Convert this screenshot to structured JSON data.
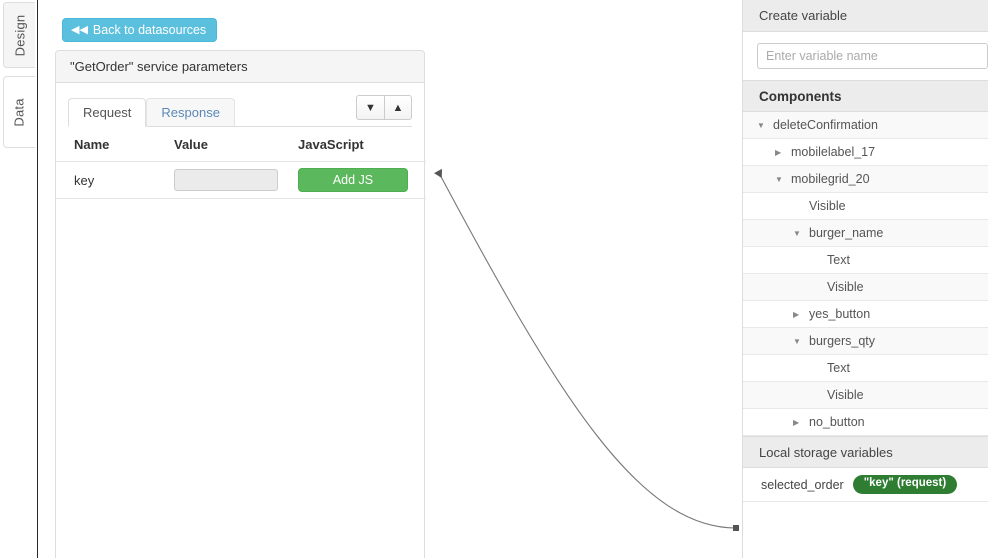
{
  "rail": {
    "tabs": [
      {
        "label": "Design",
        "active": true
      },
      {
        "label": "Data",
        "active": false
      }
    ]
  },
  "toolbar": {
    "back_label": "Back to datasources",
    "back_icon": "fast-backward-icon",
    "back_color": "#5bc0de"
  },
  "card": {
    "title": "\"GetOrder\" service parameters",
    "tabs": [
      {
        "label": "Request",
        "active": true
      },
      {
        "label": "Response",
        "active": false
      }
    ],
    "sort_buttons": [
      {
        "name": "chevron-down-icon",
        "glyph": "▼"
      },
      {
        "name": "chevron-up-icon",
        "glyph": "▲"
      }
    ],
    "table": {
      "headers": [
        "Name",
        "Value",
        "JavaScript"
      ],
      "rows": [
        {
          "name": "key",
          "value": "",
          "value_placeholder": "",
          "js_label": "Add JS",
          "js_color": "#5cb85c"
        }
      ]
    }
  },
  "right_panel": {
    "create_variable_header": "Create variable",
    "variable_placeholder": "Enter variable name",
    "variable_value": "",
    "components_header": "Components",
    "tree": [
      {
        "label": "deleteConfirmation",
        "indent": 0,
        "caret": "▼",
        "alt": true
      },
      {
        "label": "mobilelabel_17",
        "indent": 1,
        "caret": "▶",
        "alt": false
      },
      {
        "label": "mobilegrid_20",
        "indent": 1,
        "caret": "▼",
        "alt": true
      },
      {
        "label": "Visible",
        "indent": 2,
        "caret": "",
        "alt": false
      },
      {
        "label": "burger_name",
        "indent": 2,
        "caret": "▼",
        "alt": true
      },
      {
        "label": "Text",
        "indent": 3,
        "caret": "",
        "alt": false
      },
      {
        "label": "Visible",
        "indent": 3,
        "caret": "",
        "alt": true
      },
      {
        "label": "yes_button",
        "indent": 2,
        "caret": "▶",
        "alt": false
      },
      {
        "label": "burgers_qty",
        "indent": 2,
        "caret": "▼",
        "alt": true
      },
      {
        "label": "Text",
        "indent": 3,
        "caret": "",
        "alt": false
      },
      {
        "label": "Visible",
        "indent": 3,
        "caret": "",
        "alt": true
      },
      {
        "label": "no_button",
        "indent": 2,
        "caret": "▶",
        "alt": false
      }
    ],
    "local_storage_header": "Local storage variables",
    "local_storage": [
      {
        "name": "selected_order",
        "badge": "\"key\" (request)",
        "badge_color": "#2e7d32"
      }
    ]
  },
  "connector": {
    "color": "#555555",
    "description": "curved binding arrow from selected_order to Add JS"
  }
}
